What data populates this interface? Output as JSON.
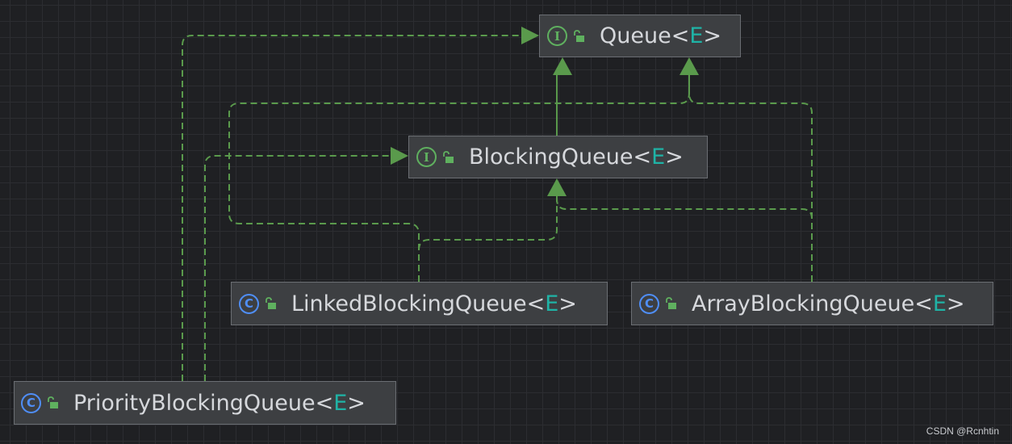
{
  "diagram": {
    "colors": {
      "edge": "#5a9a4c",
      "interface_icon": "#5fb05f",
      "class_icon": "#4f8ef7",
      "type_param": "#1fb3a6"
    },
    "nodes": {
      "queue": {
        "kind": "interface",
        "icon": "interface-icon",
        "icon_letter": "I",
        "name": "Queue",
        "lt": "<",
        "param": "E",
        "gt": ">"
      },
      "blocking_queue": {
        "kind": "interface",
        "icon": "interface-icon",
        "icon_letter": "I",
        "name": "BlockingQueue",
        "lt": "<",
        "param": "E",
        "gt": ">"
      },
      "linked_blocking_queue": {
        "kind": "class",
        "icon": "class-icon",
        "icon_letter": "C",
        "name": "LinkedBlockingQueue",
        "lt": "<",
        "param": "E",
        "gt": ">"
      },
      "array_blocking_queue": {
        "kind": "class",
        "icon": "class-icon",
        "icon_letter": "C",
        "name": "ArrayBlockingQueue",
        "lt": "<",
        "param": "E",
        "gt": ">"
      },
      "priority_blocking_queue": {
        "kind": "class",
        "icon": "class-icon",
        "icon_letter": "C",
        "name": "PriorityBlockingQueue",
        "lt": "<",
        "param": "E",
        "gt": ">"
      }
    },
    "edges": [
      {
        "from": "blocking_queue",
        "to": "queue",
        "relation": "extends"
      },
      {
        "from": "linked_blocking_queue",
        "to": "blocking_queue",
        "relation": "implements"
      },
      {
        "from": "linked_blocking_queue",
        "to": "queue",
        "relation": "implements"
      },
      {
        "from": "array_blocking_queue",
        "to": "blocking_queue",
        "relation": "implements"
      },
      {
        "from": "array_blocking_queue",
        "to": "queue",
        "relation": "implements"
      },
      {
        "from": "priority_blocking_queue",
        "to": "queue",
        "relation": "implements"
      },
      {
        "from": "priority_blocking_queue",
        "to": "blocking_queue",
        "relation": "implements"
      }
    ]
  },
  "watermark": "CSDN @Rcnhtin"
}
